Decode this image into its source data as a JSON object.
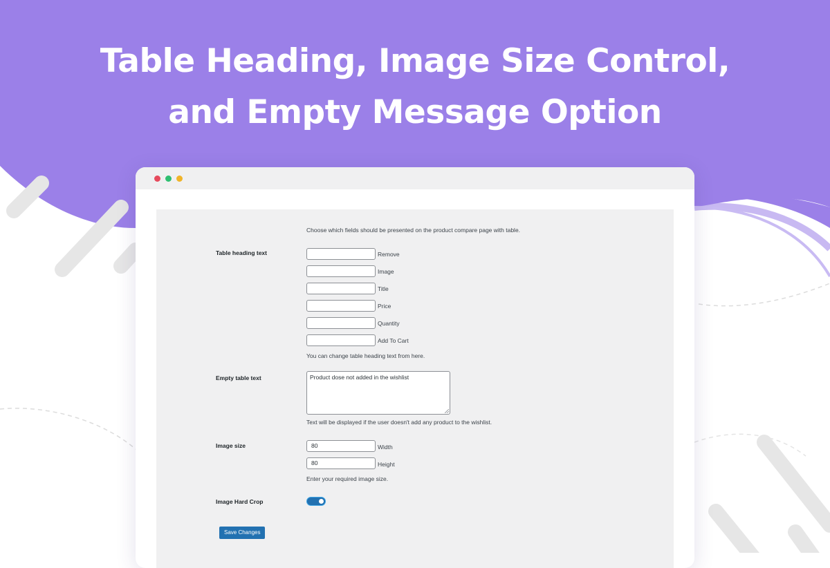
{
  "banner": {
    "title_line1": "Table Heading, Image Size Control,",
    "title_line2": "and Empty Message Option"
  },
  "colors": {
    "banner_purple": "#9b80e8",
    "button_blue": "#2271b1",
    "panel_gray": "#f0f0f1"
  },
  "browser": {
    "window_dots": [
      "red",
      "green",
      "yellow"
    ]
  },
  "settings": {
    "intro": "Choose which fields should be presented on the product compare page with table.",
    "table_heading": {
      "label": "Table heading text",
      "fields": [
        {
          "value": "",
          "caption": "Remove"
        },
        {
          "value": "",
          "caption": "Image"
        },
        {
          "value": "",
          "caption": "Title"
        },
        {
          "value": "",
          "caption": "Price"
        },
        {
          "value": "",
          "caption": "Quantity"
        },
        {
          "value": "",
          "caption": "Add To Cart"
        }
      ],
      "help": "You can change table heading text from here."
    },
    "empty_table": {
      "label": "Empty table text",
      "value": "Product dose not added in the wishlist",
      "help": "Text will be displayed if the user doesn't add any product to the wishlist."
    },
    "image_size": {
      "label": "Image size",
      "width_value": "80",
      "width_caption": "Width",
      "height_value": "80",
      "height_caption": "Height",
      "help": "Enter your required image size."
    },
    "hard_crop": {
      "label": "Image Hard Crop",
      "enabled": true
    },
    "save_label": "Save Changes"
  }
}
